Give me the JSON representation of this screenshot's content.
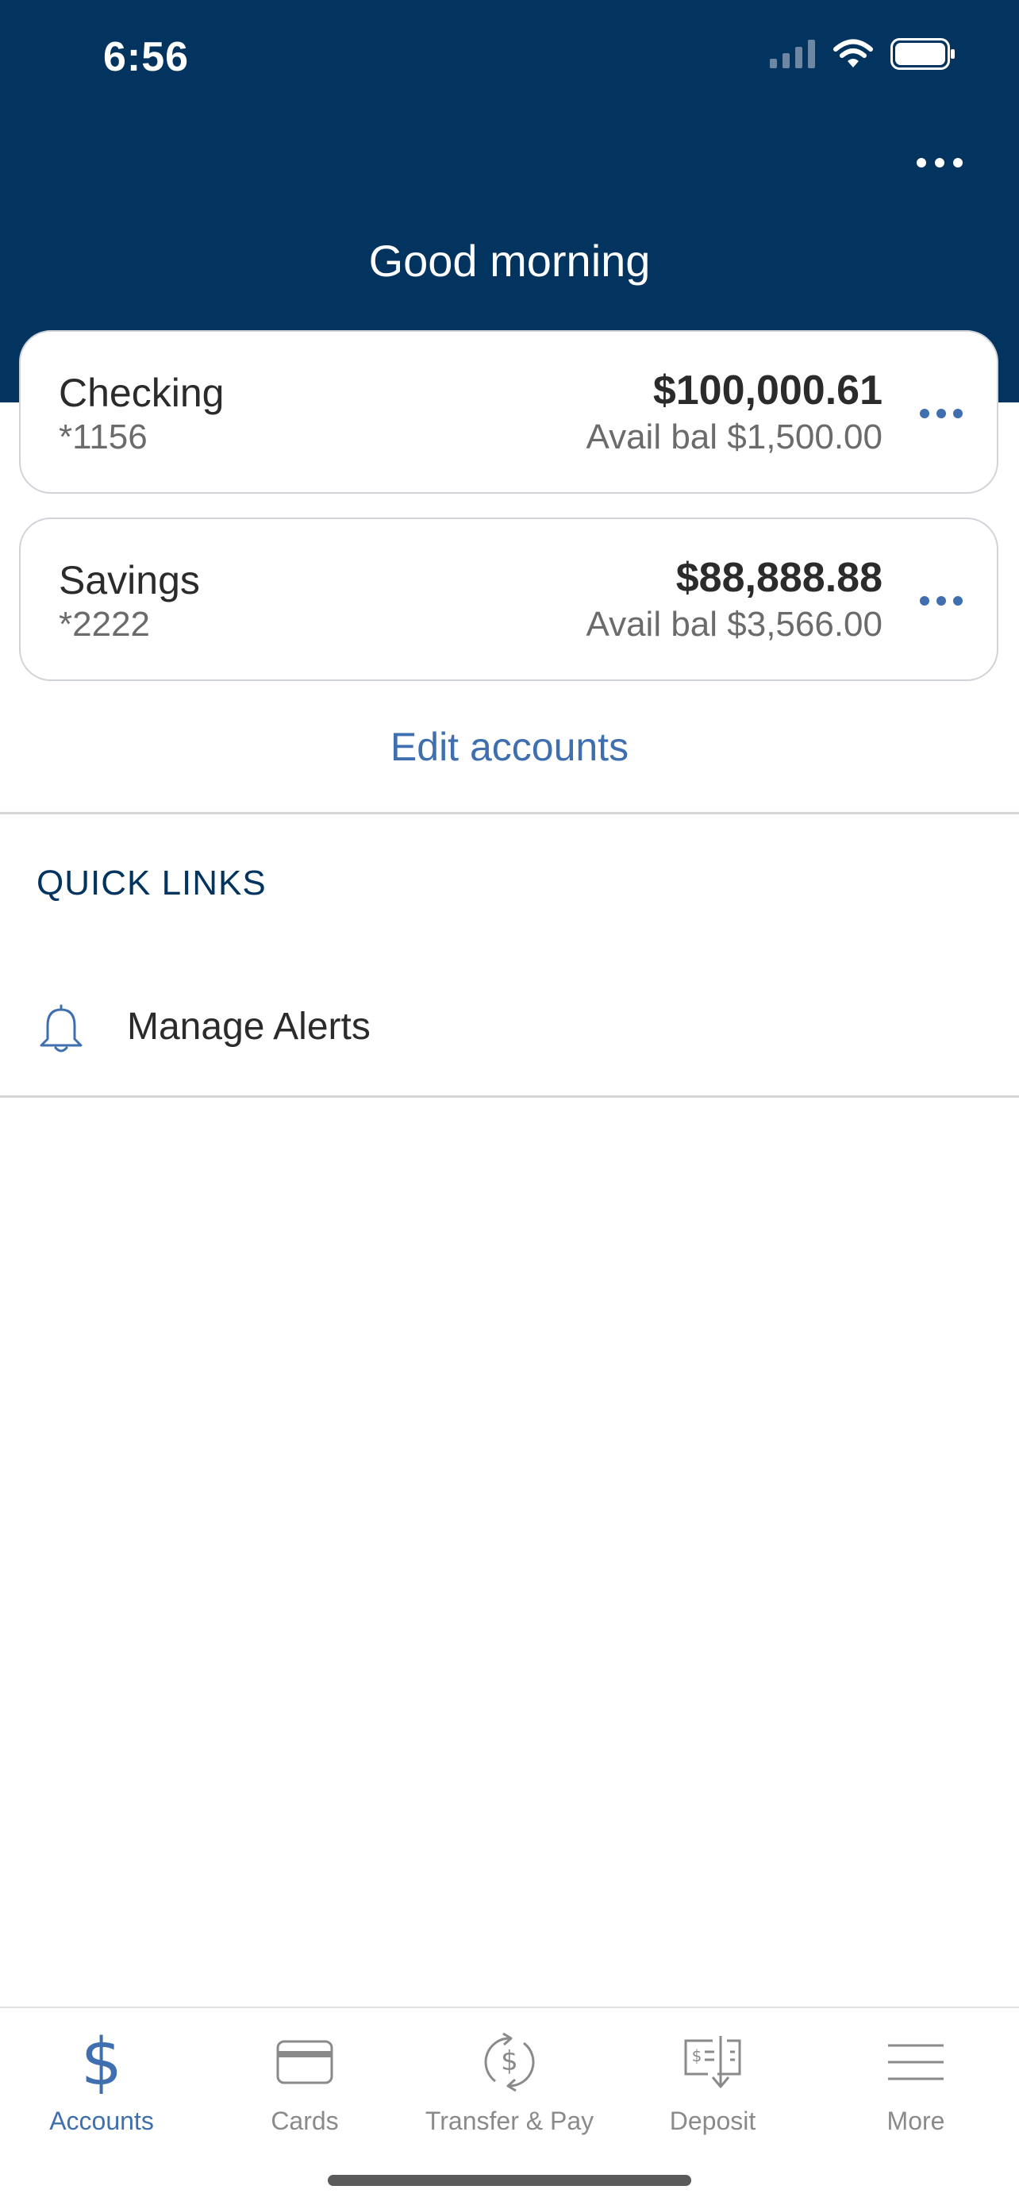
{
  "status_bar": {
    "time": "6:56"
  },
  "header": {
    "greeting": "Good morning",
    "background_color": "#03335f"
  },
  "accounts": [
    {
      "name": "Checking",
      "number": "*1156",
      "balance": "$100,000.61",
      "available": "Avail bal $1,500.00"
    },
    {
      "name": "Savings",
      "number": "*2222",
      "balance": "$88,888.88",
      "available": "Avail bal $3,566.00"
    }
  ],
  "edit_accounts_label": "Edit accounts",
  "quick_links": {
    "title": "QUICK LINKS",
    "items": [
      {
        "label": "Manage Alerts",
        "icon": "bell-icon"
      }
    ]
  },
  "tabbar": {
    "accent_color": "#3f6fae",
    "tabs": [
      {
        "label": "Accounts",
        "icon": "dollar-icon",
        "active": true
      },
      {
        "label": "Cards",
        "icon": "card-icon",
        "active": false
      },
      {
        "label": "Transfer & Pay",
        "icon": "transfer-icon",
        "active": false
      },
      {
        "label": "Deposit",
        "icon": "check-deposit-icon",
        "active": false
      },
      {
        "label": "More",
        "icon": "menu-icon",
        "active": false
      }
    ]
  }
}
